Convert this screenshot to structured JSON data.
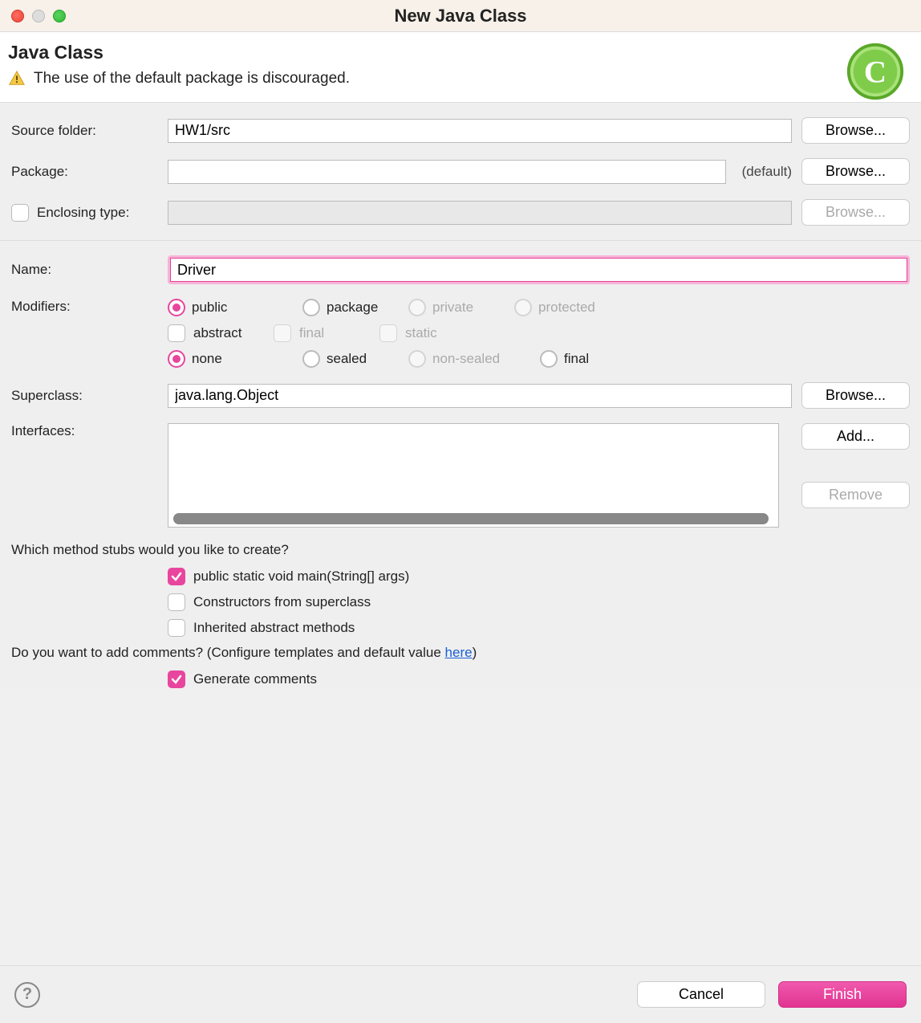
{
  "window": {
    "title": "New Java Class"
  },
  "header": {
    "title": "Java Class",
    "message": "The use of the default package is discouraged."
  },
  "fields": {
    "source_folder": {
      "label": "Source folder:",
      "value": "HW1/src",
      "browse": "Browse..."
    },
    "package": {
      "label": "Package:",
      "value": "",
      "default_text": "(default)",
      "browse": "Browse..."
    },
    "enclosing_type": {
      "label": "Enclosing type:",
      "value": "",
      "browse": "Browse..."
    },
    "name": {
      "label": "Name:",
      "value": "Driver"
    },
    "superclass": {
      "label": "Superclass:",
      "value": "java.lang.Object",
      "browse": "Browse..."
    },
    "interfaces": {
      "label": "Interfaces:",
      "add": "Add...",
      "remove": "Remove"
    }
  },
  "modifiers": {
    "label": "Modifiers:",
    "access": [
      {
        "label": "public",
        "selected": true,
        "enabled": true
      },
      {
        "label": "package",
        "selected": false,
        "enabled": true
      },
      {
        "label": "private",
        "selected": false,
        "enabled": false
      },
      {
        "label": "protected",
        "selected": false,
        "enabled": false
      }
    ],
    "flags": [
      {
        "label": "abstract",
        "checked": false,
        "enabled": true
      },
      {
        "label": "final",
        "checked": false,
        "enabled": false
      },
      {
        "label": "static",
        "checked": false,
        "enabled": false
      }
    ],
    "sealing": [
      {
        "label": "none",
        "selected": true,
        "enabled": true
      },
      {
        "label": "sealed",
        "selected": false,
        "enabled": true
      },
      {
        "label": "non-sealed",
        "selected": false,
        "enabled": false
      },
      {
        "label": "final",
        "selected": false,
        "enabled": true
      }
    ]
  },
  "stubs": {
    "question": "Which method stubs would you like to create?",
    "options": [
      {
        "label": "public static void main(String[] args)",
        "checked": true
      },
      {
        "label": "Constructors from superclass",
        "checked": false
      },
      {
        "label": "Inherited abstract methods",
        "checked": false
      }
    ]
  },
  "comments": {
    "question_prefix": "Do you want to add comments? (Configure templates and default value ",
    "link": "here",
    "question_suffix": ")",
    "option": {
      "label": "Generate comments",
      "checked": true
    }
  },
  "footer": {
    "cancel": "Cancel",
    "finish": "Finish"
  }
}
